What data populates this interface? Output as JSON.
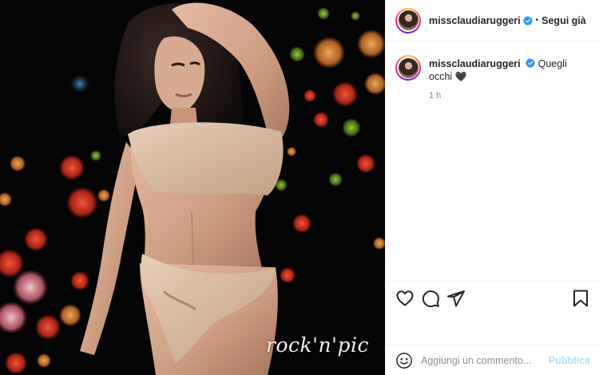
{
  "post": {
    "image_alt": "",
    "watermark": "rock'n'pic"
  },
  "header": {
    "username": "missclaudiaruggeri",
    "separator": "•",
    "follow_label": "Segui già"
  },
  "caption": {
    "username": "missclaudiaruggeri",
    "text": "Quegli occhi",
    "emoji": "🖤",
    "time": "1 h"
  },
  "actions": {
    "icons": [
      "heart-icon",
      "comment-icon",
      "share-icon",
      "bookmark-icon"
    ]
  },
  "comment_box": {
    "placeholder": "Aggiungi un commento...",
    "publish_label": "Pubblica"
  },
  "colors": {
    "verified_blue": "#3897f0",
    "publish_disabled": "#b2dffc",
    "border": "#efefef",
    "muted_text": "#8e8e8e"
  }
}
